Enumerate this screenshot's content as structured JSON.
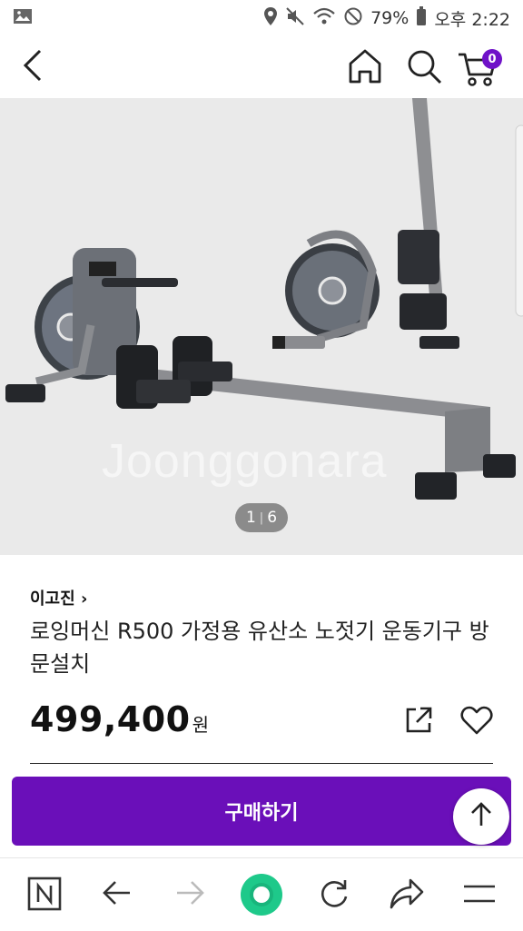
{
  "status_bar": {
    "battery": "79%",
    "time": "오후 2:22"
  },
  "header": {
    "cart_count": "0"
  },
  "product": {
    "image_counter": {
      "current": "1",
      "separator": "|",
      "total": "6"
    },
    "watermark": "Joonggonara",
    "seller": "이고진 ›",
    "title": "로잉머신 R500 가정용 유산소 노젓기 운동기구 방문설치",
    "price": "499,400",
    "price_unit": "원"
  },
  "actions": {
    "buy_label": "구매하기"
  },
  "icons": {
    "back": "back-arrow-icon",
    "home": "home-icon",
    "search": "search-icon",
    "cart": "cart-icon",
    "share": "share-icon",
    "like": "heart-icon",
    "scroll_top": "arrow-up-icon"
  },
  "colors": {
    "accent": "#6a0fb9",
    "badge": "#6f12c8",
    "browser_home": "#1ec98a"
  }
}
